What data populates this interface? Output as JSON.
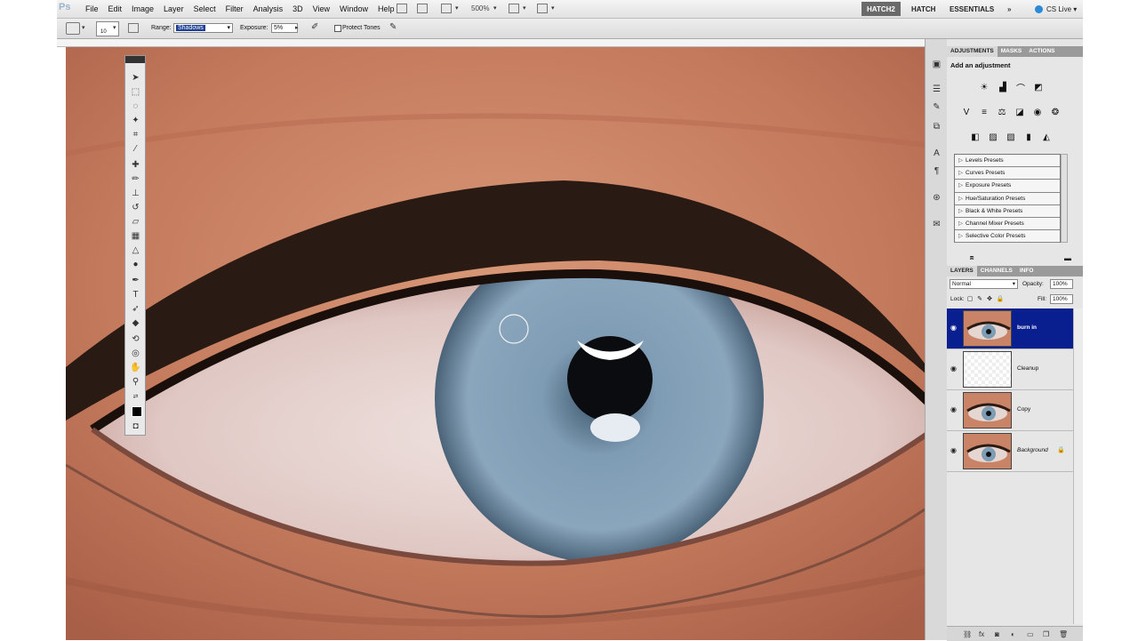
{
  "app": {
    "logo": "Ps"
  },
  "menu": [
    "File",
    "Edit",
    "Image",
    "Layer",
    "Select",
    "Filter",
    "Analysis",
    "3D",
    "View",
    "Window",
    "Help"
  ],
  "toolbar": {
    "zoom": "500%"
  },
  "workspaces": {
    "active": "HATCH2",
    "items": [
      "HATCH",
      "ESSENTIALS"
    ],
    "more": "»",
    "cslive": "CS Live ▾"
  },
  "options": {
    "brush_size": "10",
    "range_label": "Range:",
    "range_value": "Shadows",
    "exposure_label": "Exposure:",
    "exposure_value": "5%",
    "protect_tones": "Protect Tones"
  },
  "adjustments": {
    "tabs": [
      "ADJUSTMENTS",
      "MASKS",
      "ACTIONS"
    ],
    "title": "Add an adjustment",
    "presets": [
      "Levels Presets",
      "Curves Presets",
      "Exposure Presets",
      "Hue/Saturation Presets",
      "Black & White Presets",
      "Channel Mixer Presets",
      "Selective Color Presets"
    ]
  },
  "layers_panel": {
    "tabs": [
      "LAYERS",
      "CHANNELS",
      "INFO"
    ],
    "blend_mode": "Normal",
    "opacity_label": "Opacity:",
    "opacity": "100%",
    "lock_label": "Lock:",
    "fill_label": "Fill:",
    "fill": "100%",
    "layers": [
      {
        "name": "burn in",
        "selected": true
      },
      {
        "name": "Cleanup",
        "selected": false
      },
      {
        "name": "Copy",
        "selected": false
      },
      {
        "name": "Background",
        "selected": false
      }
    ]
  }
}
